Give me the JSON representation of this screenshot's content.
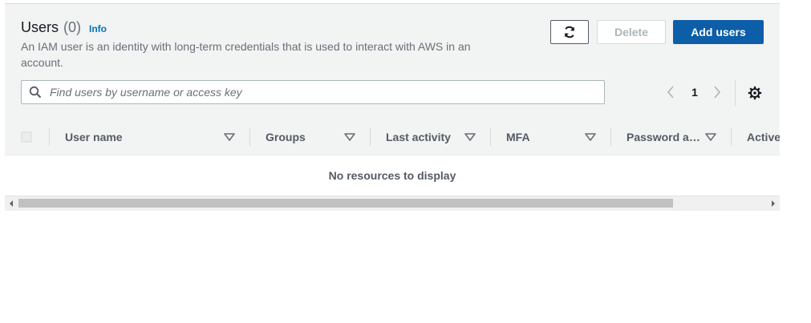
{
  "header": {
    "title": "Users",
    "count": "(0)",
    "info_label": "Info",
    "description": "An IAM user is an identity with long-term credentials that is used to interact with AWS in an account."
  },
  "actions": {
    "refresh_icon": "refresh-icon",
    "delete_label": "Delete",
    "add_label": "Add users"
  },
  "search": {
    "placeholder": "Find users by username or access key",
    "value": ""
  },
  "pagination": {
    "current_page": "1"
  },
  "table": {
    "columns": [
      "User name",
      "Groups",
      "Last activity",
      "MFA",
      "Password a…",
      "Active"
    ],
    "empty_message": "No resources to display"
  },
  "colors": {
    "primary_button": "#0d5ea9",
    "link": "#0073bb",
    "panel_bg": "#f2f3f3"
  }
}
